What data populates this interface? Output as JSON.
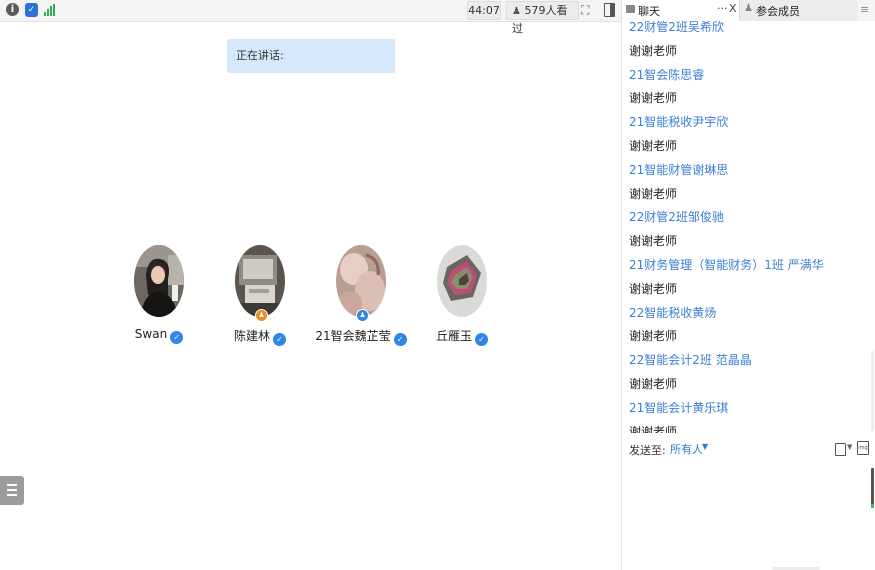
{
  "topbar": {
    "info_icon_glyph": "i",
    "shield_icon_glyph": "✓",
    "timer": "44:07",
    "viewers": "579人看过"
  },
  "tabs": {
    "chat_label": "聊天",
    "chat_more": "···",
    "chat_close": "X",
    "members_label": "参会成员",
    "menu_glyph": "≡"
  },
  "stage": {
    "speaking_label": "正在讲话:",
    "attendees": [
      {
        "name": "Swan"
      },
      {
        "name": "陈建林"
      },
      {
        "name": "21智会魏芷莹"
      },
      {
        "name": "丘雁玉"
      }
    ]
  },
  "chat": {
    "messages": [
      {
        "type": "sender",
        "text": "22财管2班吴希欣"
      },
      {
        "type": "text",
        "text": "谢谢老师"
      },
      {
        "type": "sender",
        "text": "21智会陈思睿"
      },
      {
        "type": "text",
        "text": "谢谢老师"
      },
      {
        "type": "sender",
        "text": "21智能税收尹宇欣"
      },
      {
        "type": "text",
        "text": "谢谢老师"
      },
      {
        "type": "sender",
        "text": "21智能财管谢琳思"
      },
      {
        "type": "text",
        "text": "谢谢老师"
      },
      {
        "type": "sender",
        "text": "22财管2班邹俊驰"
      },
      {
        "type": "text",
        "text": "谢谢老师"
      },
      {
        "type": "sender",
        "text": "21财务管理（智能财务）1班 严满华"
      },
      {
        "type": "text",
        "text": "谢谢老师"
      },
      {
        "type": "sender",
        "text": "22智能税收黄炀"
      },
      {
        "type": "text",
        "text": "谢谢老师"
      },
      {
        "type": "sender",
        "text": "22智能会计2班 范晶晶"
      },
      {
        "type": "text",
        "text": "谢谢老师"
      },
      {
        "type": "sender",
        "text": "21智能会计黄乐琪"
      },
      {
        "type": "text",
        "text": "谢谢老师"
      }
    ],
    "send_label": "发送至:",
    "send_target": "所有人",
    "send_caret": "▼"
  },
  "colors": {
    "accent": "#3a7fd6",
    "speaking_bg": "#d6e8fb",
    "signal": "#2bb24c"
  }
}
